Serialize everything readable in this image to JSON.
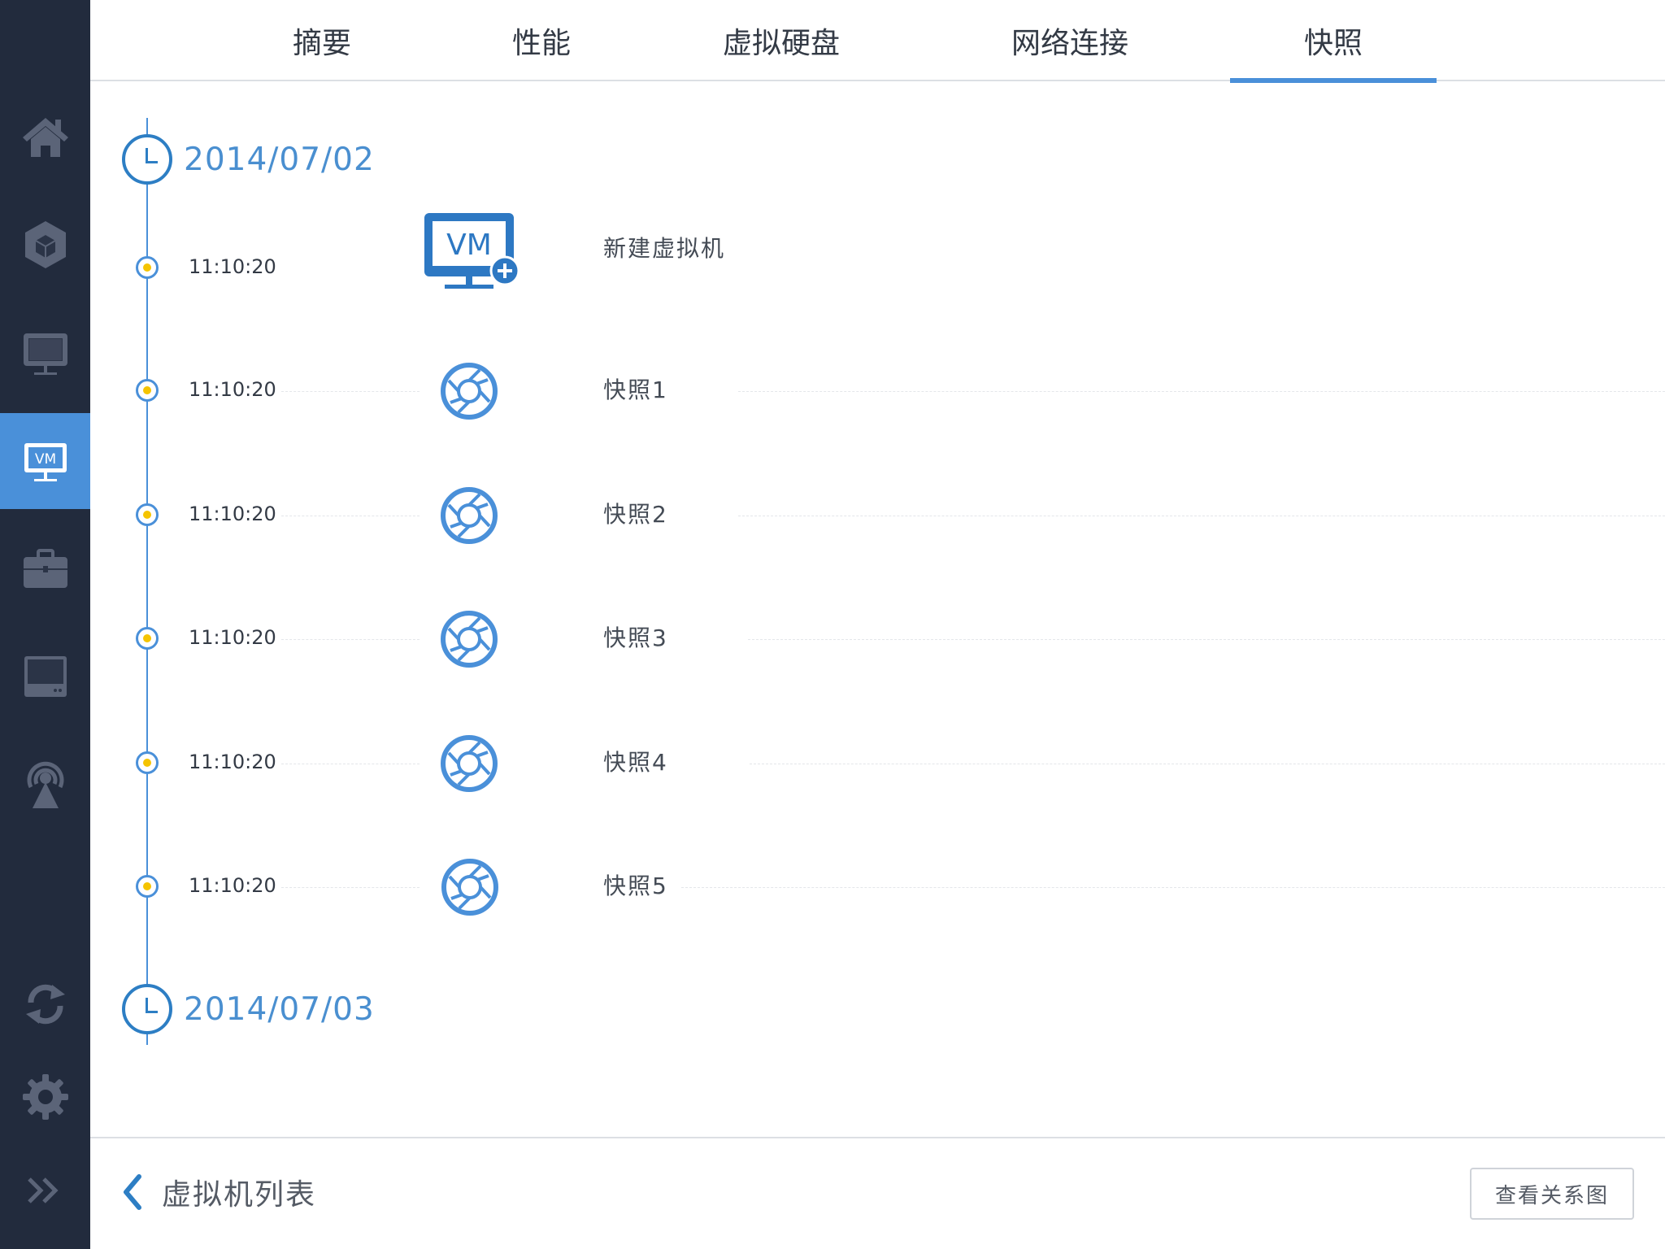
{
  "sidebar": {
    "items": [
      {
        "icon": "home-icon"
      },
      {
        "icon": "cube-icon"
      },
      {
        "icon": "monitor-icon"
      },
      {
        "icon": "vm-monitor-icon",
        "label": "VM",
        "active": true
      },
      {
        "icon": "briefcase-icon"
      },
      {
        "icon": "storage-icon"
      },
      {
        "icon": "broadcast-icon"
      },
      {
        "icon": "refresh-icon"
      },
      {
        "icon": "gear-icon"
      },
      {
        "icon": "expand-icon"
      }
    ],
    "active_color": "#4a90d9",
    "background": "#222b3d"
  },
  "tabs": [
    {
      "label": "摘要"
    },
    {
      "label": "性能"
    },
    {
      "label": "虚拟硬盘"
    },
    {
      "label": "网络连接"
    },
    {
      "label": "快照",
      "active": true
    }
  ],
  "timeline": {
    "dates": [
      "2014/07/02",
      "2014/07/03"
    ],
    "events": [
      {
        "time": "11:10:20",
        "label": "新建虚拟机",
        "icon": "vm-new-icon",
        "icon_text": "VM"
      },
      {
        "time": "11:10:20",
        "label": "快照1",
        "icon": "aperture-icon"
      },
      {
        "time": "11:10:20",
        "label": "快照2",
        "icon": "aperture-icon"
      },
      {
        "time": "11:10:20",
        "label": "快照3",
        "icon": "aperture-icon"
      },
      {
        "time": "11:10:20",
        "label": "快照4",
        "icon": "aperture-icon"
      },
      {
        "time": "11:10:20",
        "label": "快照5",
        "icon": "aperture-icon"
      }
    ],
    "accent": "#4a90d9",
    "dot_color": "#f5c400"
  },
  "footer": {
    "back_label": "虚拟机列表",
    "relation_button": "查看关系图"
  }
}
